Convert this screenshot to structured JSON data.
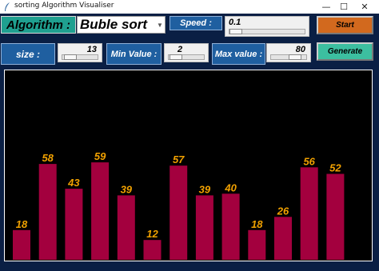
{
  "window": {
    "title": "sorting Algorithm Visualiser",
    "minimize": "—",
    "maximize": "☐",
    "close": "✕"
  },
  "controls": {
    "algorithm_label": "Algorithm :",
    "algorithm_value": "Buble sort",
    "speed_label": "Speed :",
    "speed_value": "0.1",
    "speed_fraction": 0.0,
    "start_label": "Start",
    "size_label": "size :",
    "size_value": "13",
    "size_fraction": 0.06,
    "min_label": "Min Value :",
    "min_value": "2",
    "min_fraction": 0.02,
    "max_label": "Max value :",
    "max_value": "80",
    "max_fraction": 0.8,
    "generate_label": "Generate"
  },
  "colors": {
    "background": "#0a1f44",
    "bar": "#a3003e",
    "bar_label": "#f0a000",
    "algorithm_label_bg": "#1fa090",
    "start_bg": "#d2691e",
    "generate_bg": "#3cbfa0",
    "blue_label_bg": "#1f5fa0"
  },
  "chart_data": {
    "type": "bar",
    "values": [
      18,
      58,
      43,
      59,
      39,
      12,
      57,
      39,
      40,
      18,
      26,
      56,
      52
    ],
    "ylim": [
      0,
      80
    ]
  }
}
